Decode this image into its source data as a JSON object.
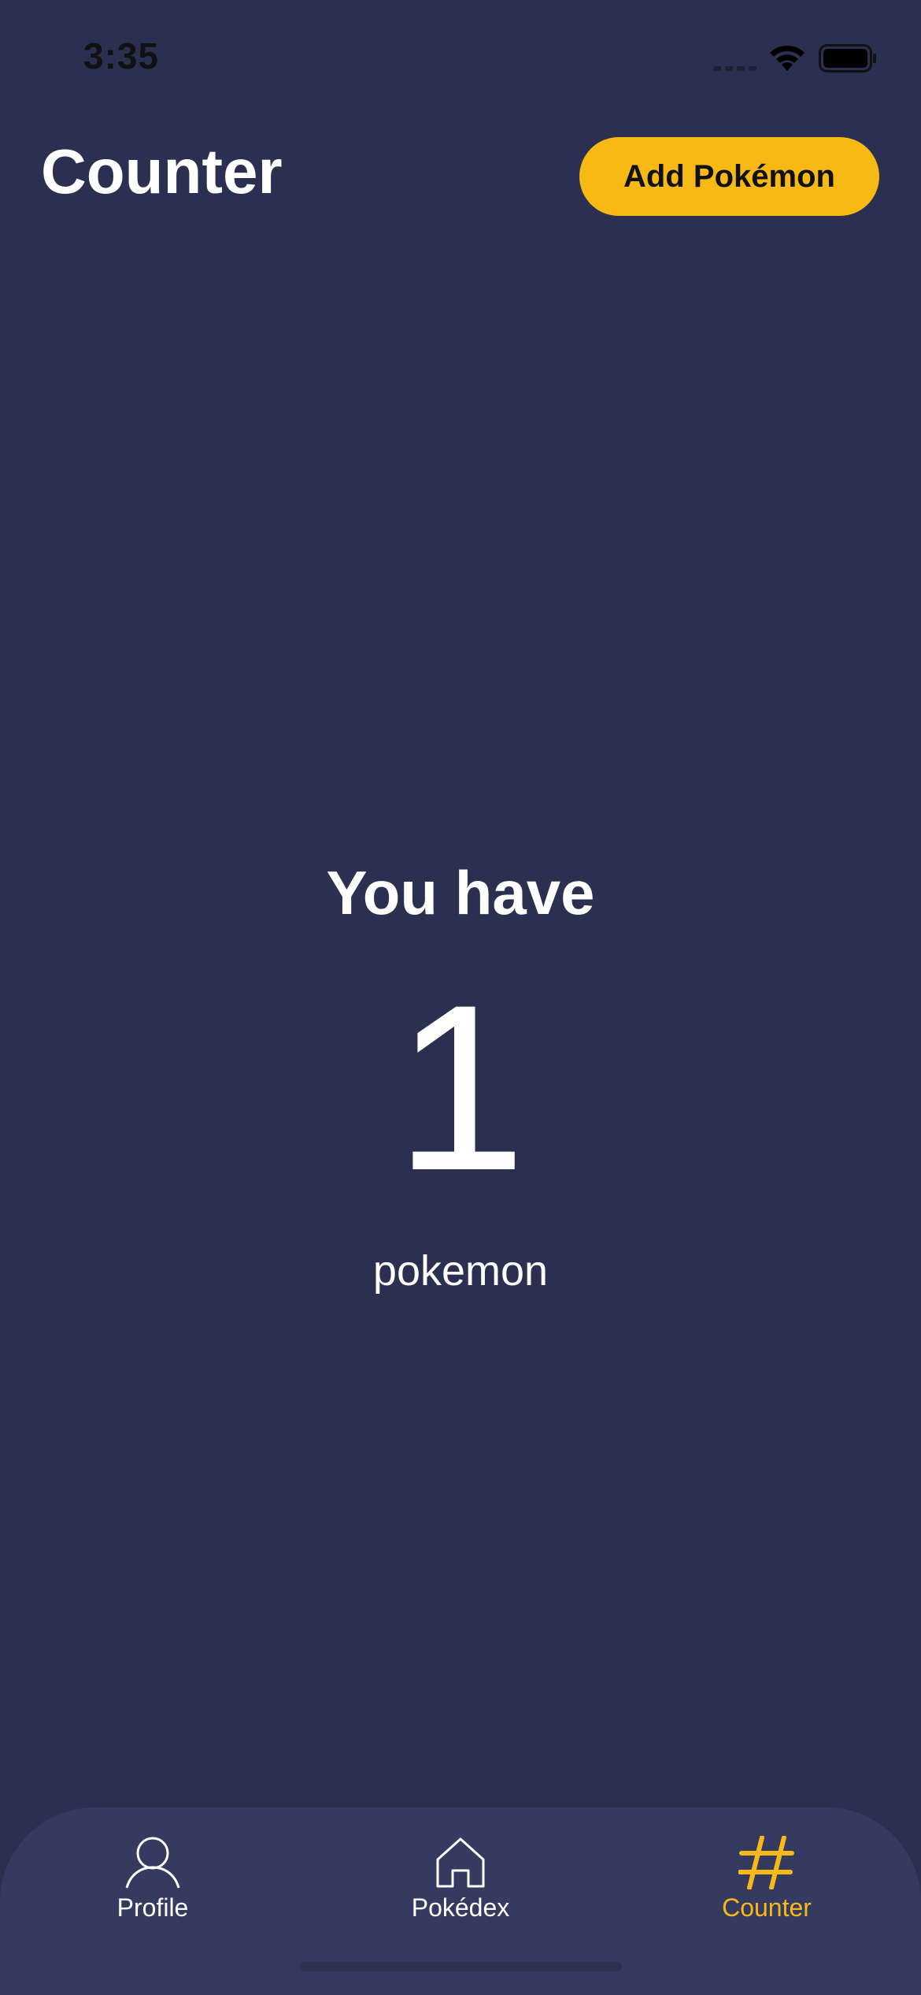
{
  "status_bar": {
    "time": "3:35"
  },
  "header": {
    "title": "Counter",
    "add_button_label": "Add Pokémon"
  },
  "counter": {
    "heading": "You have",
    "value": "1",
    "unit": "pokemon"
  },
  "tab_bar": {
    "items": [
      {
        "label": "Profile",
        "icon": "person-icon",
        "active": false
      },
      {
        "label": "Pokédex",
        "icon": "house-icon",
        "active": false
      },
      {
        "label": "Counter",
        "icon": "hash-icon",
        "active": true
      }
    ]
  },
  "colors": {
    "background": "#2b3050",
    "tab_bar": "#353b60",
    "accent": "#f6b916",
    "text": "#ffffff"
  }
}
